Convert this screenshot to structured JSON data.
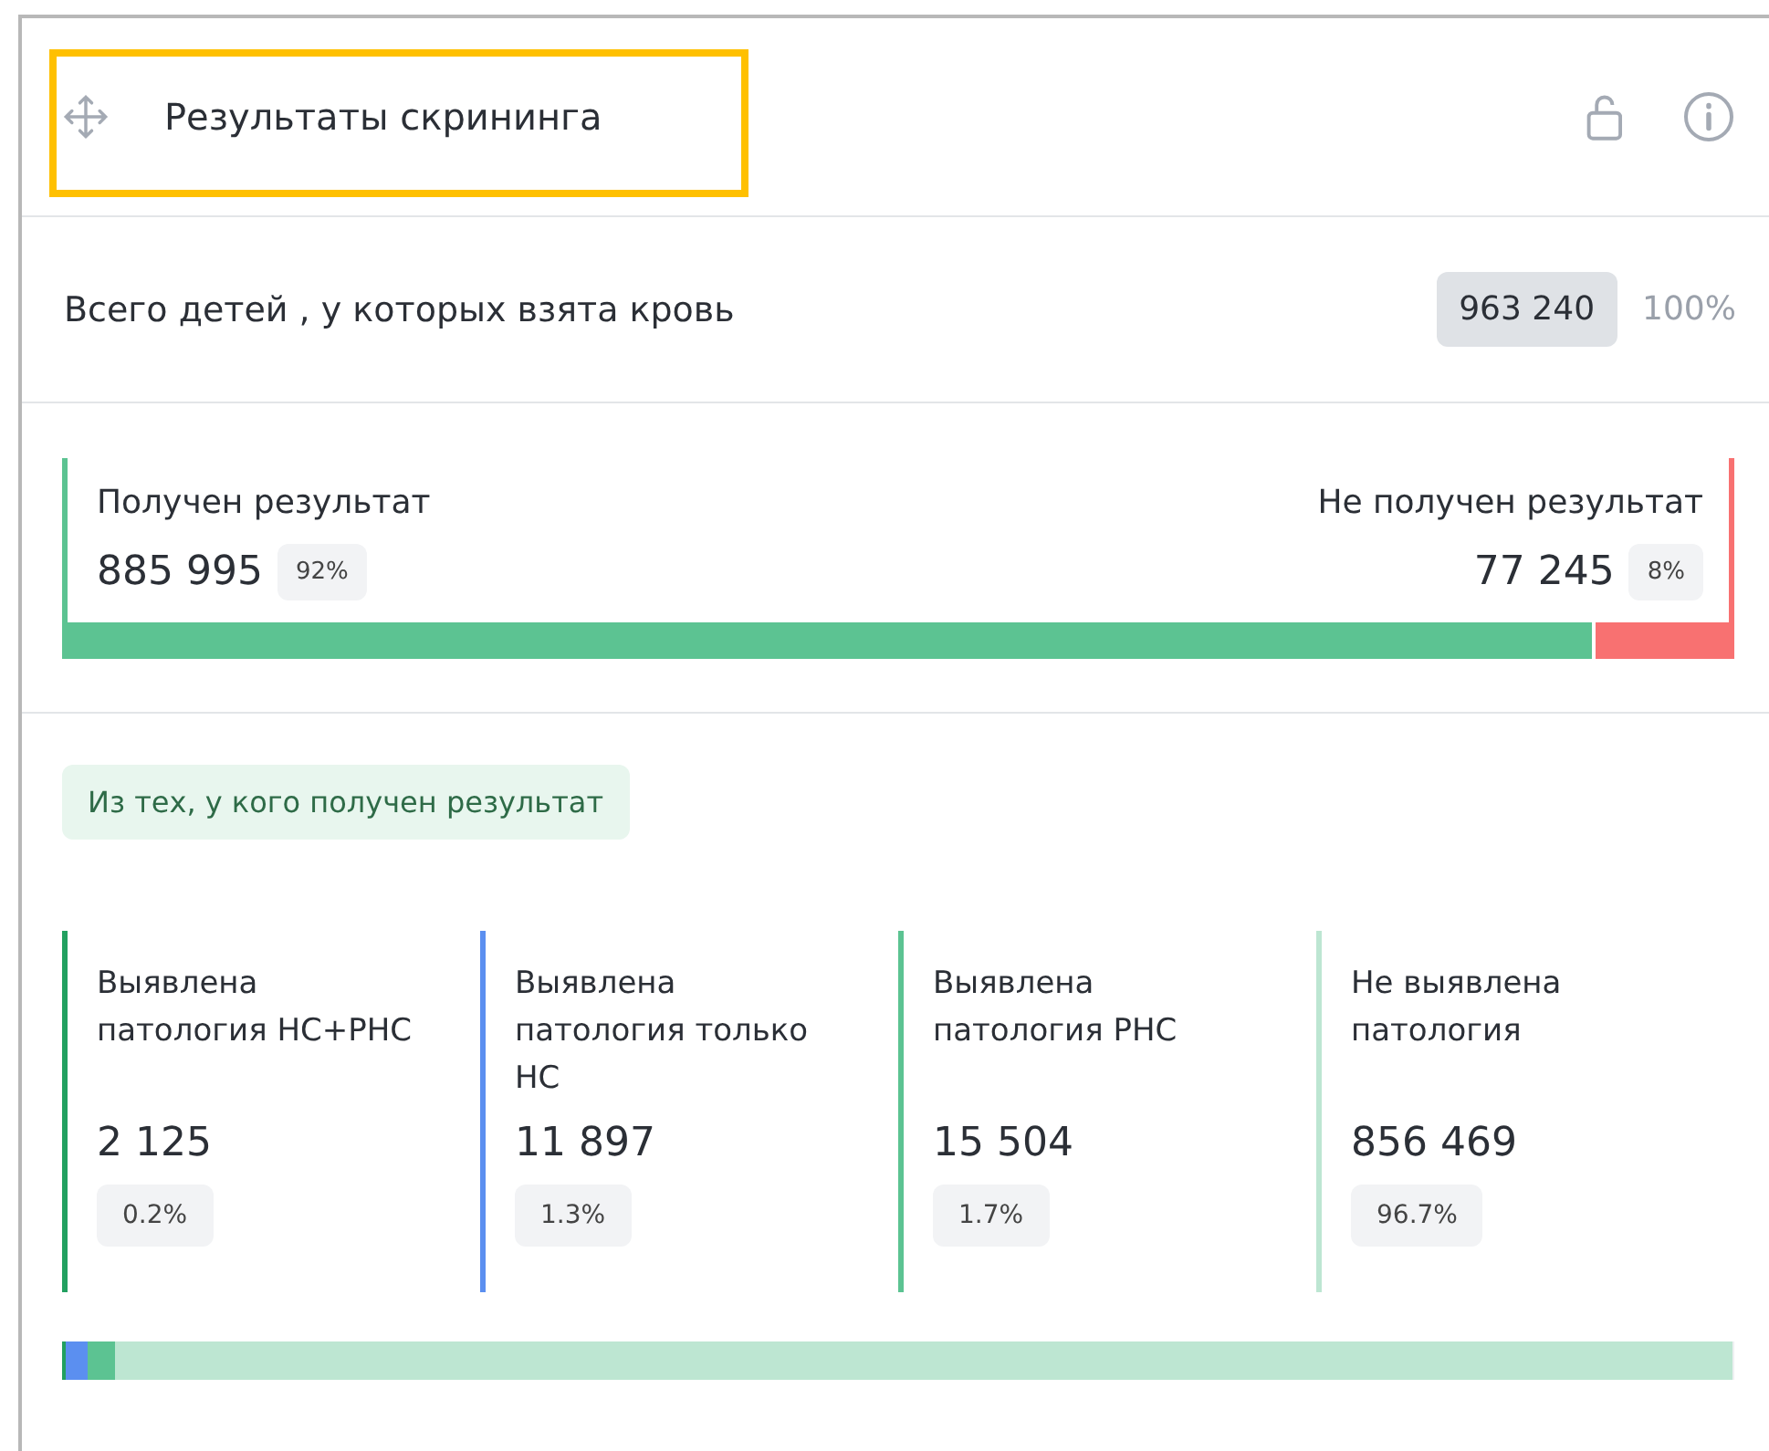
{
  "header": {
    "title": "Результаты скрининга",
    "highlighted": true
  },
  "total": {
    "label": "Всего детей , у которых взята кровь",
    "value": "963 240",
    "percent": "100%"
  },
  "results": [
    {
      "label": "Получен результат",
      "value": "885 995",
      "percent": "92%",
      "level": 0.92,
      "color": "#5cc392"
    },
    {
      "label": "Не получен результат",
      "value": "77 245",
      "percent": "8%",
      "level": 0.08,
      "color": "#f87171"
    }
  ],
  "subgroup": {
    "title": "Из тех, у кого получен результат",
    "categories": [
      {
        "label": "Выявлена патология НС+РНС",
        "value": "2 125",
        "percent": "0.2%",
        "color": "#22a060"
      },
      {
        "label": "Выявлена патология только НС",
        "value": "11 897",
        "percent": "1.3%",
        "color": "#5b8ff0"
      },
      {
        "label": "Выявлена патология РНС",
        "value": "15 504",
        "percent": "1.7%",
        "color": "#5cc392"
      },
      {
        "label": "Не выявлена патология",
        "value": "856 469",
        "percent": "96.7%",
        "color": "#bde6d2"
      }
    ]
  },
  "distribution_bar": [
    {
      "level": 0.002,
      "color": "#22a060"
    },
    {
      "level": 0.013,
      "color": "#5b8ff0"
    },
    {
      "level": 0.017,
      "color": "#5cc392"
    },
    {
      "level": 0.967,
      "color": "#bde6d2"
    }
  ]
}
